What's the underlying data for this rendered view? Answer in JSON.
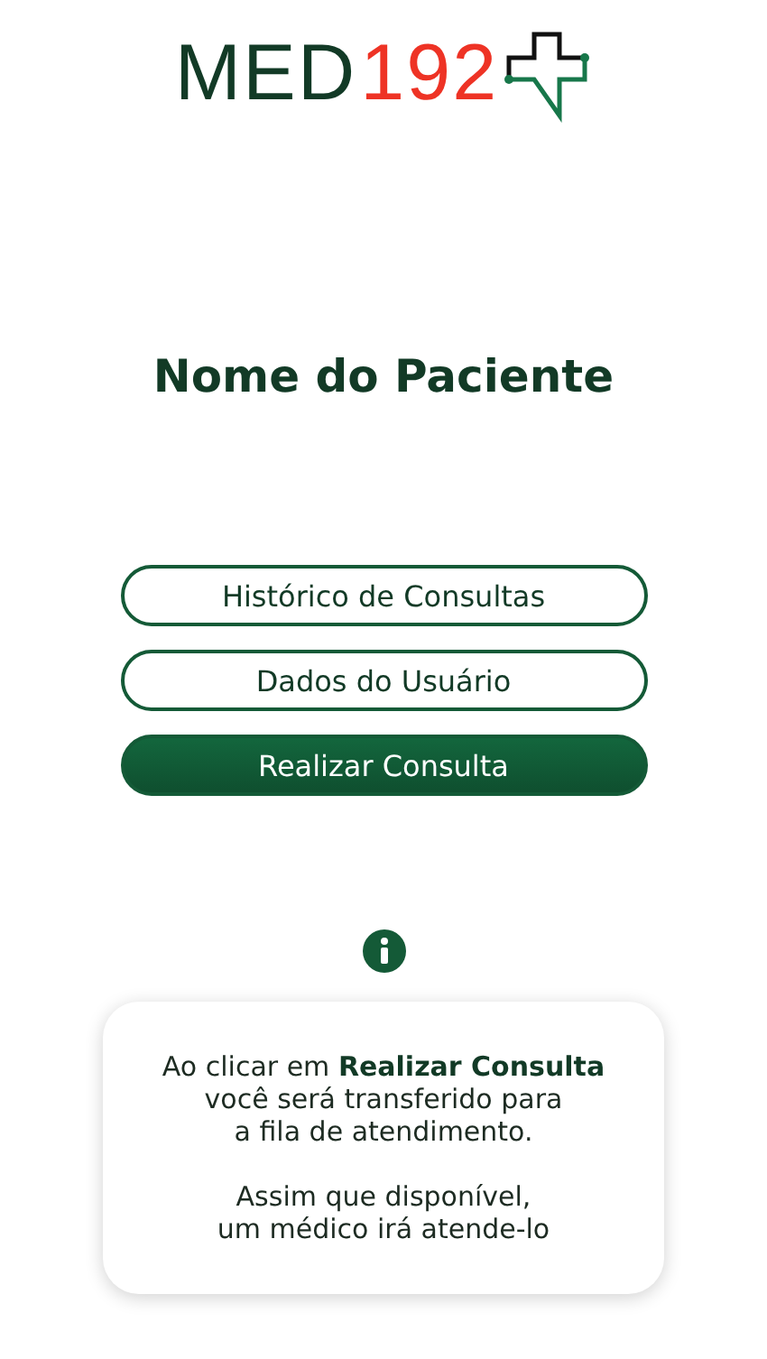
{
  "logo": {
    "text_main": "MED",
    "text_accent": "192"
  },
  "title": "Nome do Paciente",
  "buttons": [
    {
      "label": "Histórico de Consultas",
      "kind": "outline"
    },
    {
      "label": "Dados do Usuário",
      "kind": "outline"
    },
    {
      "label": "Realizar Consulta",
      "kind": "filled"
    }
  ],
  "info_card": {
    "paragraphs": [
      "Ao clicar em **Realizar Consulta**\nvocê será transferido para\na fila de atendimento.",
      "Assim que disponível,\num médico irá atende-lo"
    ]
  }
}
